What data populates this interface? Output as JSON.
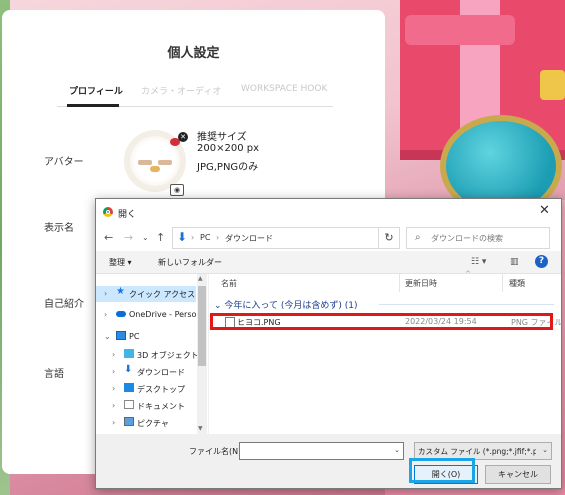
{
  "settings": {
    "title": "個人設定",
    "tabs": [
      "プロフィール",
      "カメラ・オーディオ",
      "WORKSPACE HOOK"
    ],
    "avatar_label": "アバター",
    "display_name_label": "表示名",
    "bio_label": "自己紹介",
    "language_label": "言語",
    "recommendation": [
      "推奨サイズ",
      "200×200 px",
      "JPG,PNGのみ"
    ]
  },
  "dialog": {
    "title": "開く",
    "breadcrumb": [
      "PC",
      "ダウンロード"
    ],
    "search_placeholder": "ダウンロードの検索",
    "organize": "整理 ▾",
    "new_folder": "新しいフォルダー",
    "tree": [
      {
        "label": "クイック アクセス",
        "icon": "star-icon",
        "selected": true
      },
      {
        "label": "OneDrive - Person",
        "icon": "cloud-icon",
        "selected": false
      },
      {
        "label": "PC",
        "icon": "pc-icon",
        "selected": false
      },
      {
        "label": "3D オブジェクト",
        "icon": "cube-icon",
        "selected": false
      },
      {
        "label": "ダウンロード",
        "icon": "download-icon",
        "selected": false
      },
      {
        "label": "デスクトップ",
        "icon": "desktop-icon",
        "selected": false
      },
      {
        "label": "ドキュメント",
        "icon": "document-icon",
        "selected": false
      },
      {
        "label": "ピクチャ",
        "icon": "picture-icon",
        "selected": false
      }
    ],
    "columns": {
      "name": "名前",
      "date": "更新日時",
      "type": "種類"
    },
    "group": "今年に入って (今月は含めず) (1)",
    "files": [
      {
        "name": "ヒヨコ.PNG",
        "date": "2022/03/24 19:54",
        "type": "PNG ファイル"
      }
    ],
    "filename_label": "ファイル名(N):",
    "filename_value": "",
    "filter": "カスタム ファイル (*.png;*.jfif;*.pjp;",
    "open": "開く(O)",
    "cancel": "キャンセル"
  }
}
